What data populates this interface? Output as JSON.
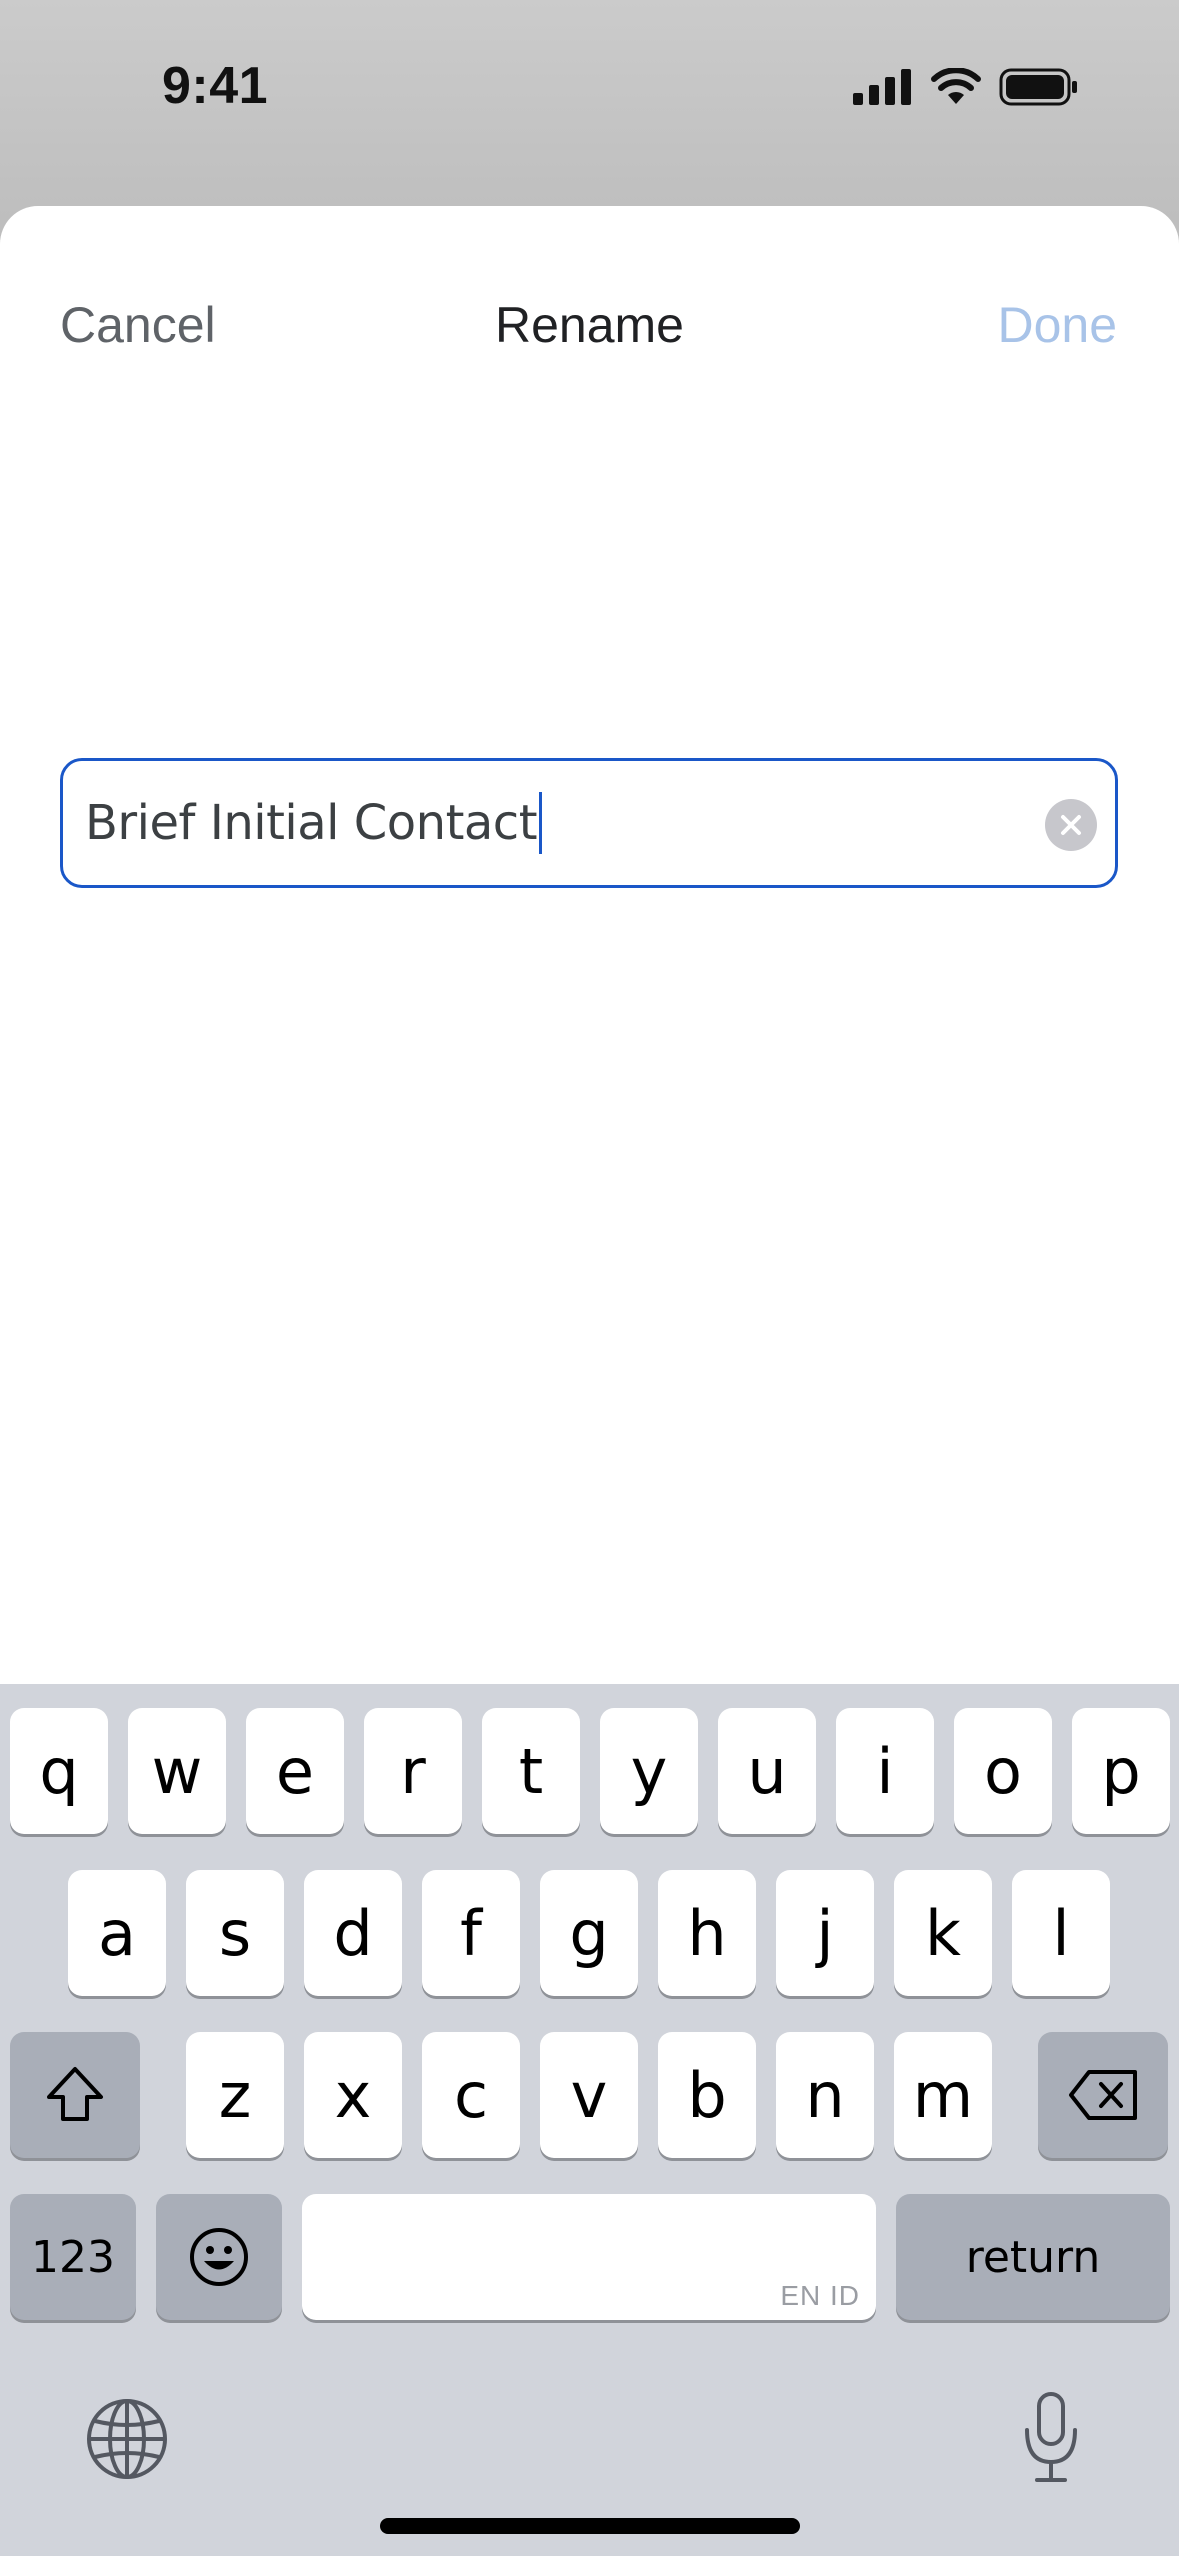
{
  "status_bar": {
    "time": "9:41",
    "icons": [
      "cellular-signal-icon",
      "wifi-icon",
      "battery-icon"
    ]
  },
  "sheet": {
    "cancel_label": "Cancel",
    "title": "Rename",
    "done_label": "Done",
    "done_color": "#a8c3e8",
    "cancel_color": "#5f6368"
  },
  "name_field": {
    "value": "Brief Initial Contact",
    "focus_border_color": "#1a57c8",
    "clear_icon": "clear-x-icon"
  },
  "keyboard": {
    "row1": [
      "q",
      "w",
      "e",
      "r",
      "t",
      "y",
      "u",
      "i",
      "o",
      "p"
    ],
    "row2": [
      "a",
      "s",
      "d",
      "f",
      "g",
      "h",
      "j",
      "k",
      "l"
    ],
    "row3": [
      "z",
      "x",
      "c",
      "v",
      "b",
      "n",
      "m"
    ],
    "numbers_label": "123",
    "return_label": "return",
    "space_hint": "EN ID",
    "icons": [
      "shift-icon",
      "backspace-icon",
      "emoji-icon",
      "globe-icon",
      "microphone-icon"
    ]
  }
}
